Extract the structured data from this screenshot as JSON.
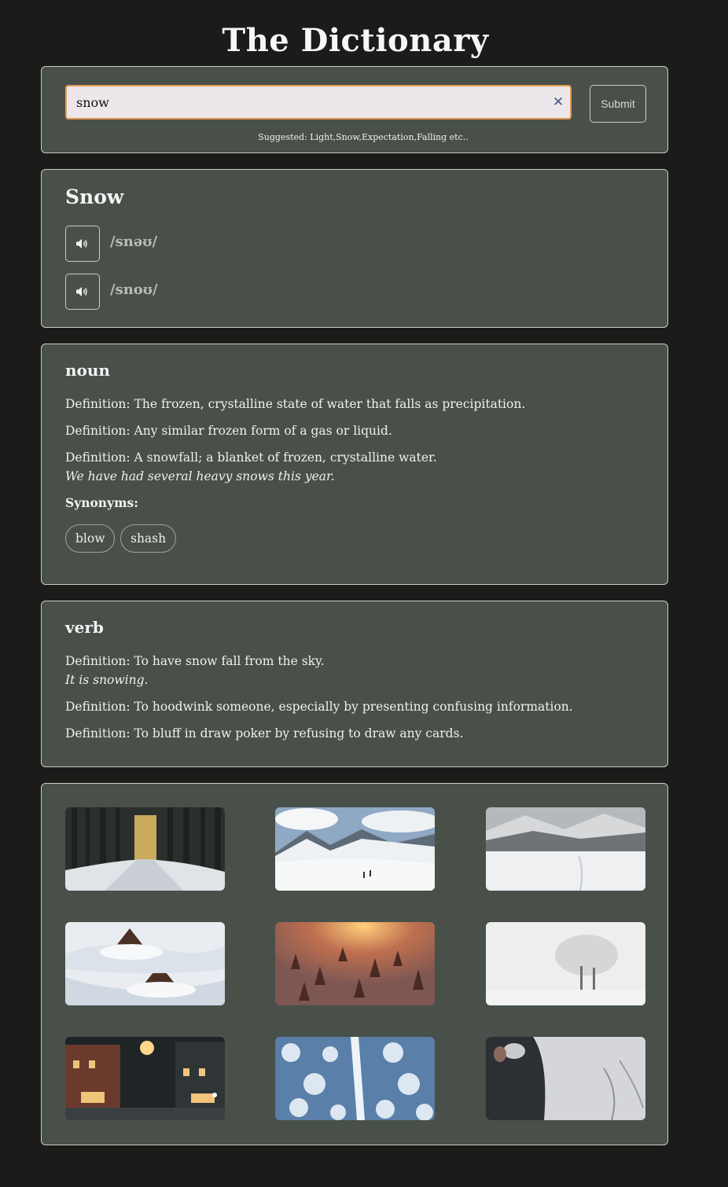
{
  "app": {
    "title": "The Dictionary"
  },
  "search": {
    "value": "snow",
    "placeholder": "",
    "clear_icon": "close-icon",
    "submit_label": "Submit",
    "suggestion": "Suggested: Light,Snow,Expectation,Falling etc.."
  },
  "word": {
    "title": "Snow",
    "phonetics": [
      {
        "text": "/snəʊ/",
        "icon": "speaker-icon"
      },
      {
        "text": "/snoʊ/",
        "icon": "speaker-icon"
      }
    ]
  },
  "meanings": [
    {
      "part_of_speech": "noun",
      "definitions": [
        {
          "text": "Definition: The frozen, crystalline state of water that falls as precipitation."
        },
        {
          "text": "Definition: Any similar frozen form of a gas or liquid."
        },
        {
          "text": "Definition: A snowfall; a blanket of frozen, crystalline water.",
          "example": "We have had several heavy snows this year."
        }
      ],
      "synonyms_label": "Synonyms:",
      "synonyms": [
        "blow",
        "shash"
      ]
    },
    {
      "part_of_speech": "verb",
      "definitions": [
        {
          "text": "Definition: To have snow fall from the sky.",
          "example": "It is snowing."
        },
        {
          "text": "Definition: To hoodwink someone, especially by presenting confusing information."
        },
        {
          "text": "Definition: To bluff in draw poker by refusing to draw any cards."
        }
      ]
    }
  ],
  "gallery": {
    "images": [
      "snowy-forest-road",
      "snow-mountain-skiers",
      "snowfield-mountain-forest",
      "snow-covered-cabins",
      "sunset-snowy-forest",
      "frosted-tree-fog",
      "snowy-town-street-night",
      "aerial-snowy-forest-road",
      "person-snow-mittens"
    ]
  },
  "colors": {
    "background": "#1b1b19",
    "card": "#485049",
    "card_border": "#c8ccc6",
    "input_bg": "#ede6ea",
    "input_border": "#e39a55",
    "clear_icon": "#3e5a86",
    "phonetic": "#b9bcb8"
  }
}
